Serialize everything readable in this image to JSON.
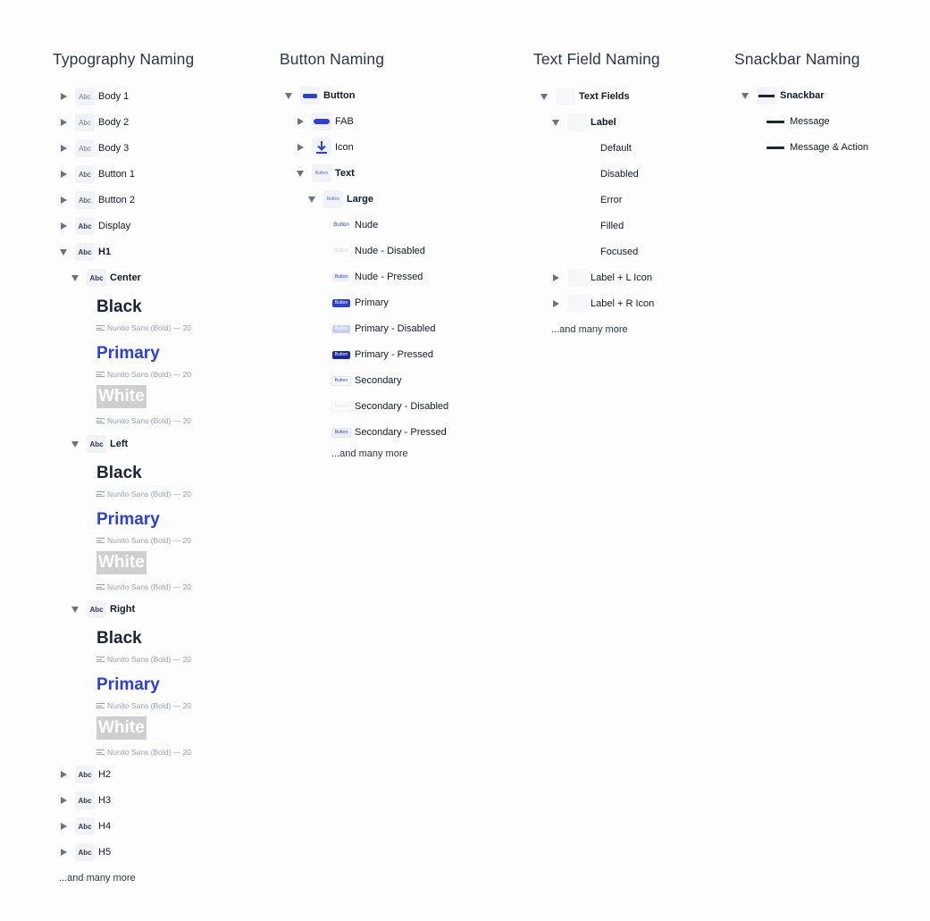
{
  "typography": {
    "title": "Typography Naming",
    "items": {
      "body1": "Body 1",
      "body2": "Body 2",
      "body3": "Body 3",
      "button1": "Button 1",
      "button2": "Button 2",
      "display": "Display",
      "h1": "H1",
      "center": "Center",
      "left": "Left",
      "right": "Right",
      "h2": "H2",
      "h3": "H3",
      "h4": "H4",
      "h5": "H5"
    },
    "thumb": "Abc",
    "samples": {
      "black": "Black",
      "primary": "Primary",
      "white": "White",
      "meta": "Nunito Sans (Bold) — 20"
    },
    "more": "...and many more"
  },
  "buttons": {
    "title": "Button Naming",
    "items": {
      "button": "Button",
      "fab": "FAB",
      "icon": "Icon",
      "text": "Text",
      "large": "Large",
      "nude": "Nude",
      "nude_disabled": "Nude - Disabled",
      "nude_pressed": "Nude - Pressed",
      "primary": "Primary",
      "primary_disabled": "Primary - Disabled",
      "primary_pressed": "Primary - Pressed",
      "secondary": "Secondary",
      "secondary_disabled": "Secondary - Disabled",
      "secondary_pressed": "Secondary - Pressed"
    },
    "thumb_text": "Button",
    "more": "...and many more"
  },
  "textfields": {
    "title": "Text Field Naming",
    "items": {
      "text_fields": "Text Fields",
      "label": "Label",
      "default": "Default",
      "disabled": "Disabled",
      "error": "Error",
      "filled": "Filled",
      "focused": "Focused",
      "label_l_icon": "Label + L Icon",
      "label_r_icon": "Label + R Icon"
    },
    "more": "...and many more"
  },
  "snackbar": {
    "title": "Snackbar Naming",
    "items": {
      "snackbar": "Snackbar",
      "message": "Message",
      "message_action": "Message & Action"
    }
  },
  "colors": {
    "primary": "#2c40d6",
    "text": "#1b2437",
    "muted": "#9aa1ad"
  }
}
